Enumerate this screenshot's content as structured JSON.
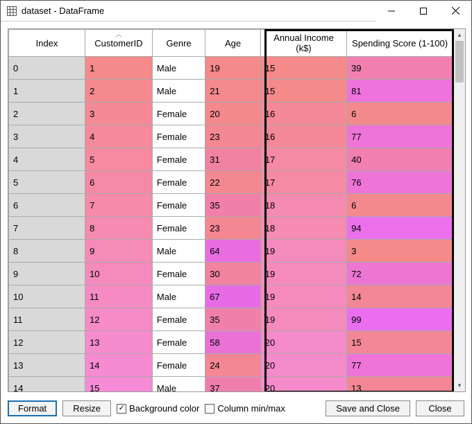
{
  "window": {
    "title": "dataset - DataFrame"
  },
  "columns": {
    "index": "Index",
    "customer_id": "CustomerID",
    "genre": "Genre",
    "age": "Age",
    "income": "Annual Income (k$)",
    "spend": "Spending Score (1-100)"
  },
  "rows": [
    {
      "index": "0",
      "customer_id": "1",
      "genre": "Male",
      "age": "19",
      "income": "15",
      "spend": "39"
    },
    {
      "index": "1",
      "customer_id": "2",
      "genre": "Male",
      "age": "21",
      "income": "15",
      "spend": "81"
    },
    {
      "index": "2",
      "customer_id": "3",
      "genre": "Female",
      "age": "20",
      "income": "16",
      "spend": "6"
    },
    {
      "index": "3",
      "customer_id": "4",
      "genre": "Female",
      "age": "23",
      "income": "16",
      "spend": "77"
    },
    {
      "index": "4",
      "customer_id": "5",
      "genre": "Female",
      "age": "31",
      "income": "17",
      "spend": "40"
    },
    {
      "index": "5",
      "customer_id": "6",
      "genre": "Female",
      "age": "22",
      "income": "17",
      "spend": "76"
    },
    {
      "index": "6",
      "customer_id": "7",
      "genre": "Female",
      "age": "35",
      "income": "18",
      "spend": "6"
    },
    {
      "index": "7",
      "customer_id": "8",
      "genre": "Female",
      "age": "23",
      "income": "18",
      "spend": "94"
    },
    {
      "index": "8",
      "customer_id": "9",
      "genre": "Male",
      "age": "64",
      "income": "19",
      "spend": "3"
    },
    {
      "index": "9",
      "customer_id": "10",
      "genre": "Female",
      "age": "30",
      "income": "19",
      "spend": "72"
    },
    {
      "index": "10",
      "customer_id": "11",
      "genre": "Male",
      "age": "67",
      "income": "19",
      "spend": "14"
    },
    {
      "index": "11",
      "customer_id": "12",
      "genre": "Female",
      "age": "35",
      "income": "19",
      "spend": "99"
    },
    {
      "index": "12",
      "customer_id": "13",
      "genre": "Female",
      "age": "58",
      "income": "20",
      "spend": "15"
    },
    {
      "index": "13",
      "customer_id": "14",
      "genre": "Female",
      "age": "24",
      "income": "20",
      "spend": "77"
    },
    {
      "index": "14",
      "customer_id": "15",
      "genre": "Male",
      "age": "37",
      "income": "20",
      "spend": "13"
    }
  ],
  "footer": {
    "format": "Format",
    "resize": "Resize",
    "bg_color_label": "Background color",
    "bg_color_checked": true,
    "col_minmax_label": "Column min/max",
    "col_minmax_checked": false,
    "save_close": "Save and Close",
    "close": "Close"
  },
  "colors": {
    "index_bg": "#d9d9d9",
    "id_ramp_low": "#f48a8a",
    "id_ramp_high": "#f68bd8",
    "age_low": "#f48a8a",
    "age_high": "#e86be6",
    "income_low": "#f48a8a",
    "income_high": "#f58bca",
    "spend_low": "#f48a8a",
    "spend_high": "#ec6ef0"
  }
}
